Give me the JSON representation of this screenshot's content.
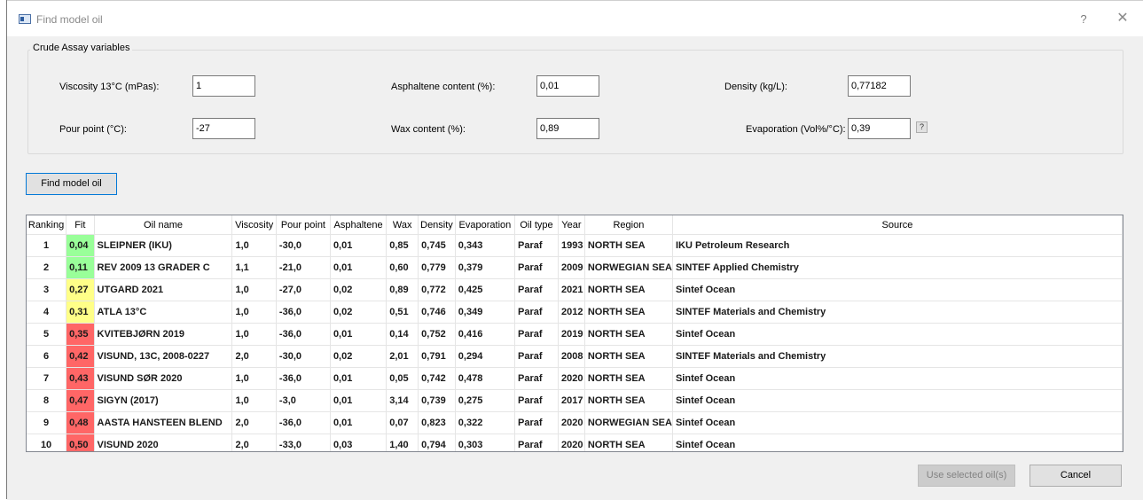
{
  "window": {
    "title": "Find model oil",
    "help_label": "?",
    "close_label": "✕"
  },
  "assay": {
    "group_title": "Crude Assay variables",
    "viscosity_label": "Viscosity 13°C (mPas):",
    "viscosity_value": "1",
    "pour_point_label": "Pour point (°C):",
    "pour_point_value": "-27",
    "asphaltene_label": "Asphaltene content (%):",
    "asphaltene_value": "0,01",
    "wax_label": "Wax content (%):",
    "wax_value": "0,89",
    "density_label": "Density (kg/L):",
    "density_value": "0,77182",
    "evaporation_label": "Evaporation (Vol%/°C):",
    "evaporation_value": "0,39",
    "evaporation_help": "?"
  },
  "find_button": "Find model oil",
  "table": {
    "columns": [
      "Ranking",
      "Fit",
      "Oil name",
      "Viscosity",
      "Pour point",
      "Asphaltene",
      "Wax",
      "Density",
      "Evaporation",
      "Oil type",
      "Year",
      "Region",
      "Source"
    ],
    "rows": [
      [
        "1",
        "0,04",
        "SLEIPNER (IKU)",
        "1,0",
        "-30,0",
        "0,01",
        "0,85",
        "0,745",
        "0,343",
        "Paraf",
        "1993",
        "NORTH SEA",
        "IKU Petroleum Research"
      ],
      [
        "2",
        "0,11",
        "REV 2009 13 GRADER C",
        "1,1",
        "-21,0",
        "0,01",
        "0,60",
        "0,779",
        "0,379",
        "Paraf",
        "2009",
        "NORWEGIAN SEA",
        "SINTEF Applied Chemistry"
      ],
      [
        "3",
        "0,27",
        "UTGARD 2021",
        "1,0",
        "-27,0",
        "0,02",
        "0,89",
        "0,772",
        "0,425",
        "Paraf",
        "2021",
        "NORTH SEA",
        "Sintef Ocean"
      ],
      [
        "4",
        "0,31",
        "ATLA 13°C",
        "1,0",
        "-36,0",
        "0,02",
        "0,51",
        "0,746",
        "0,349",
        "Paraf",
        "2012",
        "NORTH SEA",
        "SINTEF Materials and Chemistry"
      ],
      [
        "5",
        "0,35",
        "KVITEBJØRN 2019",
        "1,0",
        "-36,0",
        "0,01",
        "0,14",
        "0,752",
        "0,416",
        "Paraf",
        "2019",
        "NORTH SEA",
        "Sintef Ocean"
      ],
      [
        "6",
        "0,42",
        "VISUND, 13C, 2008-0227",
        "2,0",
        "-30,0",
        "0,02",
        "2,01",
        "0,791",
        "0,294",
        "Paraf",
        "2008",
        "NORTH SEA",
        "SINTEF Materials and Chemistry"
      ],
      [
        "7",
        "0,43",
        "VISUND SØR 2020",
        "1,0",
        "-36,0",
        "0,01",
        "0,05",
        "0,742",
        "0,478",
        "Paraf",
        "2020",
        "NORTH SEA",
        "Sintef Ocean"
      ],
      [
        "8",
        "0,47",
        "SIGYN (2017)",
        "1,0",
        "-3,0",
        "0,01",
        "3,14",
        "0,739",
        "0,275",
        "Paraf",
        "2017",
        "NORTH SEA",
        "Sintef Ocean"
      ],
      [
        "9",
        "0,48",
        "AASTA HANSTEEN BLEND",
        "2,0",
        "-36,0",
        "0,01",
        "0,07",
        "0,823",
        "0,322",
        "Paraf",
        "2020",
        "NORWEGIAN SEA",
        "Sintef Ocean"
      ],
      [
        "10",
        "0,50",
        "VISUND 2020",
        "2,0",
        "-33,0",
        "0,03",
        "1,40",
        "0,794",
        "0,303",
        "Paraf",
        "2020",
        "NORTH SEA",
        "Sintef Ocean"
      ]
    ],
    "fit_colors": [
      "#99ff99",
      "#99ff99",
      "#ffff88",
      "#ffff88",
      "#ff6666",
      "#ff6666",
      "#ff6666",
      "#ff6666",
      "#ff6666",
      "#ff6666"
    ]
  },
  "use_selected_button": "Use selected oil(s)",
  "cancel_button": "Cancel"
}
